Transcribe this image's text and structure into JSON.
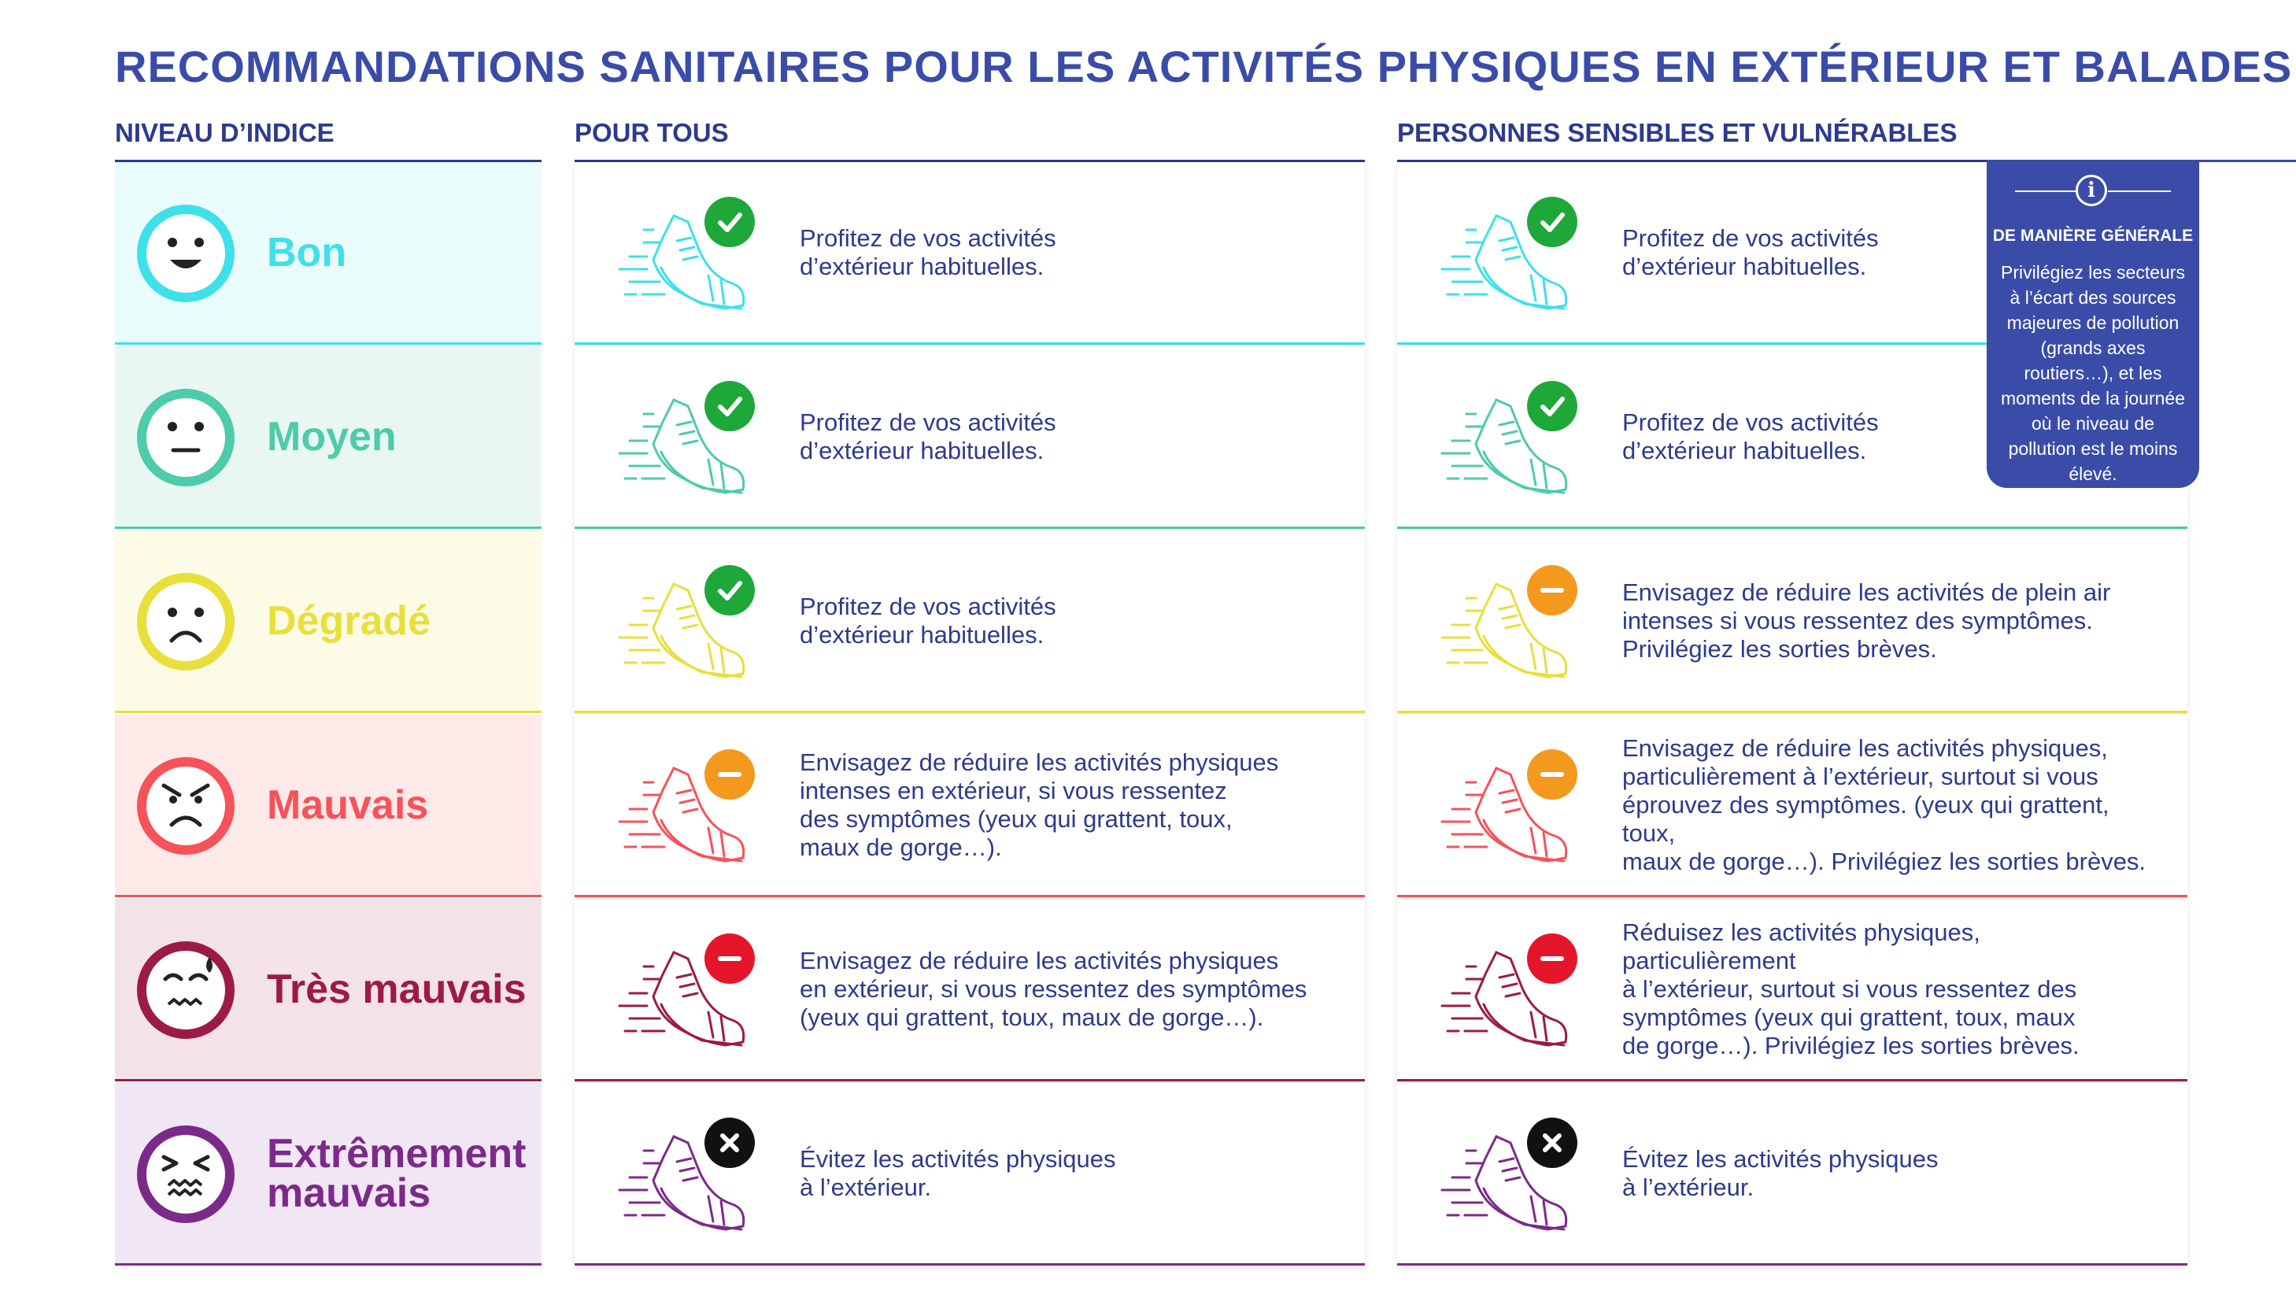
{
  "title": "RECOMMANDATIONS SANITAIRES POUR LES ACTIVITÉS PHYSIQUES EN EXTÉRIEUR ET BALADES",
  "columns": {
    "level": "NIVEAU D’INDICE",
    "all": "POUR TOUS",
    "sensitive": "PERSONNES SENSIBLES ET VULNÉRABLES"
  },
  "info": {
    "icon": "info-icon",
    "title": "DE MANIÈRE GÉNÉRALE",
    "text": "Privilégiez les secteurs à l’écart des sources majeures de pollution (grands axes routiers…), et les moments de la journée où le niveau de pollution est le moins élevé."
  },
  "rows": [
    {
      "level": "Bon",
      "color": "#3ee0ea",
      "bg": "#eafbfc",
      "face": "happy",
      "all": {
        "status": "check",
        "text": "Profitez de vos activités\nd’extérieur habituelles."
      },
      "sensitive": {
        "status": "check",
        "text": "Profitez de vos activités\nd’extérieur habituelles."
      }
    },
    {
      "level": "Moyen",
      "color": "#4ecba9",
      "bg": "#e8f7f2",
      "face": "neutral",
      "all": {
        "status": "check",
        "text": "Profitez de vos activités\nd’extérieur habituelles."
      },
      "sensitive": {
        "status": "check",
        "text": "Profitez de vos activités\nd’extérieur habituelles."
      }
    },
    {
      "level": "Dégradé",
      "color": "#e8df3c",
      "bg": "#fcfbe6",
      "face": "sad",
      "all": {
        "status": "check",
        "text": "Profitez de vos activités\nd’extérieur habituelles."
      },
      "sensitive": {
        "status": "minus-orange",
        "text": "Envisagez de réduire les activités de plein air\nintenses si vous ressentez des symptômes.\nPrivilégiez les sorties brèves."
      }
    },
    {
      "level": "Mauvais",
      "color": "#f5535a",
      "bg": "#fde9e8",
      "face": "angry",
      "all": {
        "status": "minus-orange",
        "text": "Envisagez de réduire les activités physiques\nintenses  en extérieur, si vous ressentez\ndes symptômes (yeux qui grattent, toux,\nmaux de gorge…)."
      },
      "sensitive": {
        "status": "minus-orange",
        "text": "Envisagez de réduire les activités physiques,\nparticulièrement à l’extérieur, surtout si vous\néprouvez des symptômes. (yeux qui grattent, toux,\nmaux de gorge…). Privilégiez  les sorties brèves."
      }
    },
    {
      "level": "Très mauvais",
      "color": "#9c1b45",
      "bg": "#f3e2e8",
      "face": "sweat",
      "all": {
        "status": "minus-red",
        "text": "Envisagez de réduire les activités physiques\nen extérieur, si vous ressentez des symptômes\n(yeux qui grattent, toux, maux de gorge…)."
      },
      "sensitive": {
        "status": "minus-red",
        "text": "Réduisez les activités physiques, particulièrement\nà l’extérieur, surtout si vous ressentez des\nsymptômes (yeux qui grattent, toux, maux\nde gorge…). Privilégiez les sorties brèves."
      }
    },
    {
      "level": "Extrêmement\nmauvais",
      "color": "#7c2a8a",
      "bg": "#f1e6f3",
      "face": "sick",
      "all": {
        "status": "cross",
        "text": "Évitez les activités physiques\nà l’extérieur."
      },
      "sensitive": {
        "status": "cross",
        "text": "Évitez les activités physiques\nà l’extérieur."
      }
    }
  ],
  "status_colors": {
    "check": "#1fa83a",
    "minus-orange": "#f39a1e",
    "minus-red": "#e5162b",
    "cross": "#111111"
  }
}
